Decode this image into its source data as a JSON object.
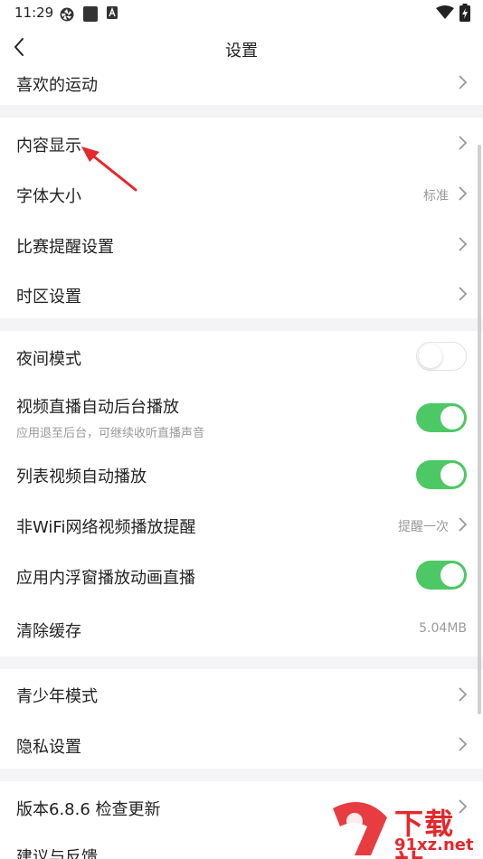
{
  "status_bar": {
    "time": "11:29"
  },
  "header": {
    "title": "设置"
  },
  "sections": [
    {
      "items": [
        {
          "label": "喜欢的运动"
        }
      ]
    },
    {
      "items": [
        {
          "label": "内容显示"
        },
        {
          "label": "字体大小",
          "value": "标准"
        },
        {
          "label": "比赛提醒设置"
        },
        {
          "label": "时区设置"
        }
      ]
    },
    {
      "items": [
        {
          "label": "夜间模式",
          "toggle": "off"
        },
        {
          "label": "视频直播自动后台播放",
          "sublabel": "应用退至后台，可继续收听直播声音",
          "toggle": "on"
        },
        {
          "label": "列表视频自动播放",
          "toggle": "on"
        },
        {
          "label": "非WiFi网络视频播放提醒",
          "value": "提醒一次"
        },
        {
          "label": "应用内浮窗播放动画直播",
          "toggle": "on"
        },
        {
          "label": "清除缓存",
          "value": "5.04MB"
        }
      ]
    },
    {
      "items": [
        {
          "label": "青少年模式"
        },
        {
          "label": "隐私设置"
        }
      ]
    },
    {
      "items": [
        {
          "label": "版本6.8.6  检查更新"
        },
        {
          "label": "建议与反馈"
        }
      ]
    }
  ],
  "watermark": {
    "brand": "下载站",
    "url": "91xz.net"
  },
  "colors": {
    "toggle_on": "#4cc864",
    "arrow": "#e4282c",
    "background": "#f4f4f6"
  }
}
